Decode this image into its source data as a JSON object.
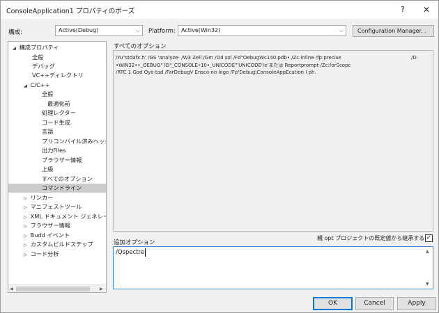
{
  "window": {
    "title": "ConsoleApplication1 プロパティのボーズ",
    "help_label": "?",
    "close_label": "✕"
  },
  "config": {
    "label": "構成:",
    "value": "Active(Debug)",
    "platform_label": "Platform:",
    "platform_value": "Active(Win32)",
    "manager_label": "Configuration Manager. ."
  },
  "tree": {
    "items": [
      {
        "label": "構成プロパティ",
        "expander": "◢"
      },
      {
        "label": "全般",
        "expander": ""
      },
      {
        "label": "デバッグ",
        "expander": ""
      },
      {
        "label": "VC++ディレクトリ",
        "expander": ""
      },
      {
        "label": "C/C++",
        "expander": "◢"
      },
      {
        "label": "全般",
        "expander": ""
      },
      {
        "label": "最適化前",
        "expander": ""
      },
      {
        "label": "処理レクター",
        "expander": ""
      },
      {
        "label": "コード生成",
        "expander": ""
      },
      {
        "label": "言語",
        "expander": ""
      },
      {
        "label": "プリコンパイル済みヘッダー",
        "expander": ""
      },
      {
        "label": "出力Files",
        "expander": ""
      },
      {
        "label": "ブラウザー情報",
        "expander": ""
      },
      {
        "label": "上級",
        "expander": ""
      },
      {
        "label": "すべてのオプション",
        "expander": ""
      },
      {
        "label": "コマンドライン",
        "expander": ""
      },
      {
        "label": "リンカー",
        "expander": "▷"
      },
      {
        "label": "マニフェストツール",
        "expander": "▷"
      },
      {
        "label": "XML ドキュメント ジェネレーター",
        "expander": "▷"
      },
      {
        "label": "ブラウザー情報",
        "expander": "▷"
      },
      {
        "label": "Budd イベント",
        "expander": "▷"
      },
      {
        "label": "カスタムビルドステップ",
        "expander": "▷"
      },
      {
        "label": "コード分析",
        "expander": "▷"
      }
    ],
    "scroll_left": "◀",
    "scroll_right": "▶"
  },
  "all_options": {
    "label": "すべてのオプション",
    "lines": [
      "/Yu\"stdafx.h' /GS 'analyze- /W3 Zell /Gm /Od sol /Fd\"OebugWc140.pdb• /Zc:inline /fp:precise",
      "•WIN32••_OEBUG\" ID\"_CONSOLE•10•_UNICODE\"'UNICODE'/e'または Reportprompt /Zc:forScopc",
      "/RTC 1 God Oyo tad /FarDebugV Ensco no logo /Fp'Debug\\ConsoleAppEcation I ph."
    ],
    "suffix": "/D"
  },
  "extra_options": {
    "label": "追加オプション",
    "inherit_label": "親 opt プロジェクトの既定値から継承する",
    "inherit_checked": true,
    "check_mark": "✓",
    "value": "/Qspectre",
    "scroll_up": "▲",
    "scroll_down": "▼"
  },
  "buttons": {
    "ok": "OK",
    "cancel": "Cancel",
    "apply": "Apply"
  }
}
